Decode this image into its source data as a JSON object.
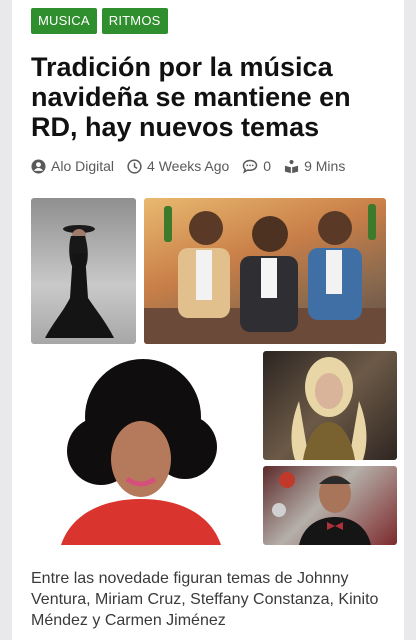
{
  "tags": [
    "MUSICA",
    "RITMOS"
  ],
  "title": "Tradición por la música navideña se mantiene en RD, hay nuevos temas",
  "meta": {
    "author": "Alo Digital",
    "date": "4 Weeks Ago",
    "comments": "0",
    "read_time": "9 Mins",
    "icons": [
      "user-icon",
      "clock-icon",
      "comment-icon",
      "reading-time-icon"
    ]
  },
  "gallery": [
    "woman-in-black-gown-photo",
    "cartoon-singers-illustration",
    "curly-hair-singer-photo",
    "blonde-singer-photo",
    "man-bowtie-christmas-photo"
  ],
  "excerpt": "Entre las novedade figuran temas de Johnny Ventura, Miriam Cruz, Steffany Constanza, Kinito Méndez y Carmen Jiménez",
  "colors": {
    "tag_bg": "#2f8f2f",
    "title": "#111111",
    "meta": "#5a5a5a"
  }
}
